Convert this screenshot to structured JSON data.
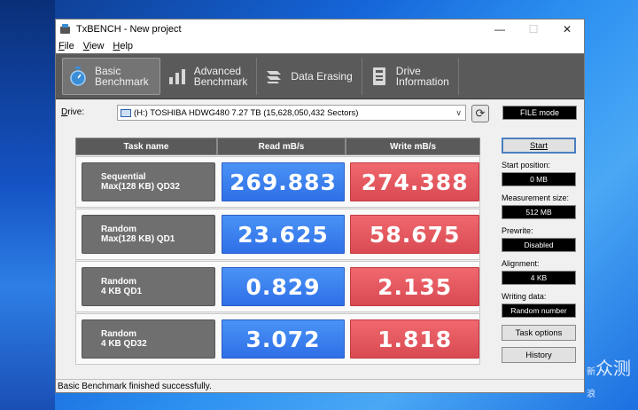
{
  "window": {
    "title": "TxBENCH - New project"
  },
  "menu": [
    {
      "label": "File",
      "key": "F"
    },
    {
      "label": "View",
      "key": "V"
    },
    {
      "label": "Help",
      "key": "H"
    }
  ],
  "toolbar": {
    "tabs": [
      {
        "line1": "Basic",
        "line2": "Benchmark",
        "icon": "stopwatch-icon",
        "active": true
      },
      {
        "line1": "Advanced",
        "line2": "Benchmark",
        "icon": "bar-chart-icon",
        "active": false
      },
      {
        "line1": "Data Erasing",
        "line2": "",
        "icon": "eraser-icon",
        "active": false
      },
      {
        "line1": "Drive",
        "line2": "Information",
        "icon": "drive-info-icon",
        "active": false
      }
    ]
  },
  "drive": {
    "label": "Drive:",
    "selected": "(H:) TOSHIBA HDWG480  7.27 TB (15,628,050,432 Sectors)",
    "mode": "FILE mode"
  },
  "grid": {
    "headers": {
      "task": "Task name",
      "read": "Read mB/s",
      "write": "Write mB/s"
    },
    "rows": [
      {
        "line1": "Sequential",
        "line2": "Max(128 KB) QD32",
        "read": "269.883",
        "write": "274.388"
      },
      {
        "line1": "Random",
        "line2": "Max(128 KB) QD1",
        "read": "23.625",
        "write": "58.675"
      },
      {
        "line1": "Random",
        "line2": "4 KB QD1",
        "read": "0.829",
        "write": "2.135"
      },
      {
        "line1": "Random",
        "line2": "4 KB QD32",
        "read": "3.072",
        "write": "1.818"
      }
    ]
  },
  "side": {
    "start": "Start",
    "start_position_label": "Start position:",
    "start_position": "0 MB",
    "measurement_size_label": "Measurement size:",
    "measurement_size": "512 MB",
    "prewrite_label": "Prewrite:",
    "prewrite": "Disabled",
    "alignment_label": "Alignment:",
    "alignment": "4 KB",
    "writing_data_label": "Writing data:",
    "writing_data": "Random number",
    "task_options": "Task options",
    "history": "History"
  },
  "status": "Basic Benchmark finished successfully.",
  "watermark": {
    "line1": "新",
    "line2": "浪",
    "mark": "众测"
  },
  "colors": {
    "read": "#3a7ff0",
    "write": "#e5545c",
    "toolbar": "#5a5a5a"
  }
}
